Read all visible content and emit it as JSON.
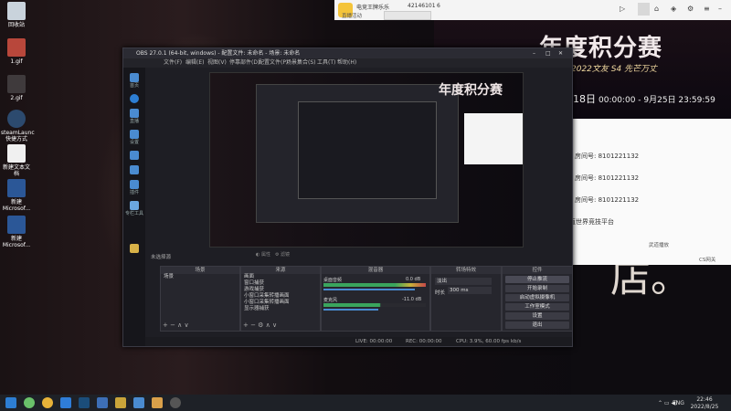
{
  "desktop": {
    "icons": [
      {
        "label": "回收站"
      },
      {
        "label": "1.gif"
      },
      {
        "label": "2.gif"
      },
      {
        "label": "steamLaunc 快捷方式"
      },
      {
        "label": "新建文本文档"
      },
      {
        "label": "新建 Microsof..."
      },
      {
        "label": "新建 Microsof..."
      }
    ]
  },
  "wallpaper_text": {
    "store_char": "店。"
  },
  "obs": {
    "title": "OBS 27.0.1 (64-bit, windows) - 配置文件: 未命名 - 场景: 未命名",
    "menu": [
      "文件(F)",
      "编辑(E)",
      "视图(V)",
      "停靠部件(D)",
      "配置文件(P)",
      "场景集合(S)",
      "工具(T)",
      "帮助(H)"
    ],
    "sidebar": [
      "首页",
      "",
      "直播",
      "",
      "设置",
      "",
      "",
      "",
      "",
      "插件",
      "专栏工具"
    ],
    "no_source": "未选择源",
    "source_props_btn": "属性",
    "source_filter_btn": "滤镜",
    "panels": {
      "scenes": {
        "title": "场景",
        "items": [
          "场景"
        ]
      },
      "sources": {
        "title": "来源",
        "items": [
          "画面",
          "窗口捕获",
          "游戏捕获",
          "小窗口采集转播画面",
          "小窗口采集转播画面",
          "显示器捕获"
        ]
      },
      "mixer": {
        "title": "混音器",
        "channels": [
          {
            "name": "桌面音频",
            "level": "0.0 dB"
          },
          {
            "name": "麦克风",
            "level": "-11.0 dB"
          }
        ]
      },
      "transitions": {
        "title": "转场特效",
        "type": "淡出",
        "duration_label": "时长",
        "duration": "300 ms"
      },
      "controls": {
        "title": "控件",
        "buttons": [
          "停止推流",
          "开始录制",
          "启动虚拟摄像机",
          "工作室模式",
          "设置",
          "退出"
        ]
      }
    },
    "status": {
      "live": "LIVE: 00:00:00",
      "rec": "REC: 00:00:00",
      "cpu": "CPU: 3.9%, 60.00 fps",
      "kbps": "kb/s"
    }
  },
  "chat": {
    "title": "电竞王牌乐乐",
    "id": "42146101",
    "count": "6",
    "dropdown": "直播活动"
  },
  "banner": {
    "headline": "年度积分赛",
    "sub": "2022文友 S4 先芒万丈",
    "time_prefix": "18日",
    "time": "00:00:00 - 9月25日 23:59:59"
  },
  "rooms": {
    "items": [
      "房间号: 8101221132",
      "房间号: 8101221132",
      "房间号: 8101221132"
    ],
    "footer": "直世界竞技平台",
    "bottom_left": "武道播放",
    "bottom_right": "CS网关"
  },
  "taskbar": {
    "lang": "ENG",
    "time": "22:46",
    "date": "2022/8/25"
  }
}
